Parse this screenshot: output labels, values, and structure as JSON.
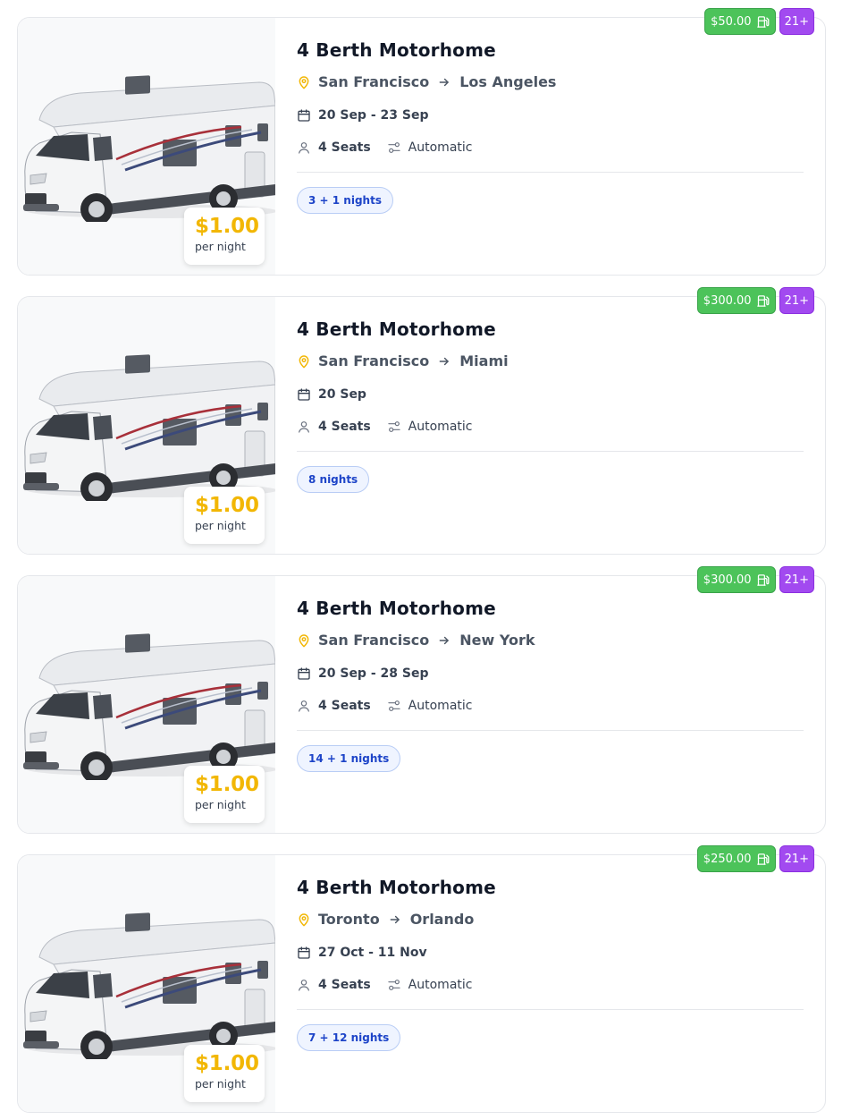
{
  "listings": [
    {
      "title": "4 Berth Motorhome",
      "from": "San Francisco",
      "to": "Los Angeles",
      "dates": "20 Sep - 23 Sep",
      "seats": "4 Seats",
      "transmission": "Automatic",
      "nights": "3 + 1 nights",
      "price": "$1.00",
      "price_unit": "per night",
      "fuel_fee": "$50.00",
      "age": "21+"
    },
    {
      "title": "4 Berth Motorhome",
      "from": "San Francisco",
      "to": "Miami",
      "dates": "20 Sep",
      "seats": "4 Seats",
      "transmission": "Automatic",
      "nights": "8 nights",
      "price": "$1.00",
      "price_unit": "per night",
      "fuel_fee": "$300.00",
      "age": "21+"
    },
    {
      "title": "4 Berth Motorhome",
      "from": "San Francisco",
      "to": "New York",
      "dates": "20 Sep - 28 Sep",
      "seats": "4 Seats",
      "transmission": "Automatic",
      "nights": "14 + 1 nights",
      "price": "$1.00",
      "price_unit": "per night",
      "fuel_fee": "$300.00",
      "age": "21+"
    },
    {
      "title": "4 Berth Motorhome",
      "from": "Toronto",
      "to": "Orlando",
      "dates": "27 Oct - 11 Nov",
      "seats": "4 Seats",
      "transmission": "Automatic",
      "nights": "7 + 12 nights",
      "price": "$1.00",
      "price_unit": "per night",
      "fuel_fee": "$250.00",
      "age": "21+"
    }
  ],
  "icons": {
    "location": "map-pin-icon",
    "route_arrow": "arrow-right-icon",
    "dates": "calendar-icon",
    "seats": "person-icon",
    "transmission": "transmission-icon",
    "fuel": "fuel-pump-icon"
  },
  "colors": {
    "price": "#f2b705",
    "fuel_badge": "#4cc35a",
    "age_badge": "#a24af0",
    "nights_pill_text": "#1d44c8",
    "pin": "#f2b705"
  }
}
